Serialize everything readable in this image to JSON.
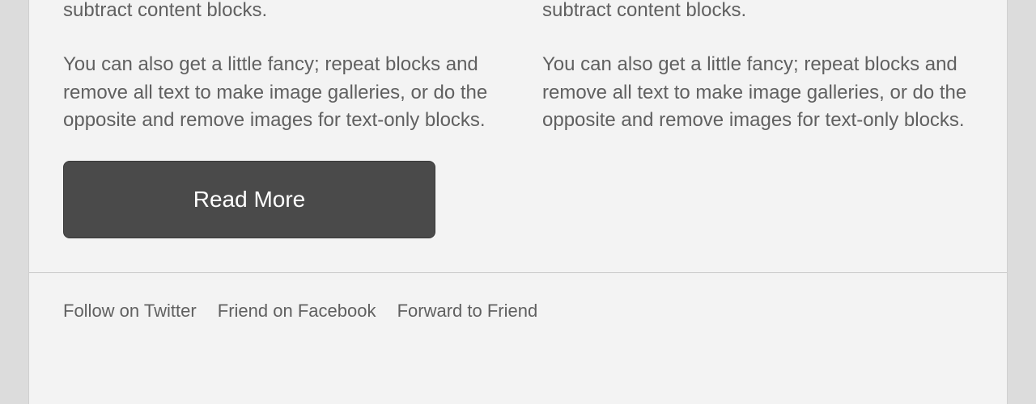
{
  "columns": {
    "left": {
      "partial_top": "subtract content blocks.",
      "paragraph2": "You can also get a little fancy; repeat blocks and remove all text to make image galleries, or do the opposite and remove images for text-only blocks.",
      "button_label": "Read More"
    },
    "right": {
      "partial_top": "subtract content blocks.",
      "paragraph2": "You can also get a little fancy; repeat blocks and remove all text to make image galleries, or do the opposite and remove images for text-only blocks."
    }
  },
  "footer": {
    "follow_twitter": "Follow on Twitter",
    "friend_facebook": "Friend on Facebook",
    "forward_friend": "Forward to Friend"
  }
}
